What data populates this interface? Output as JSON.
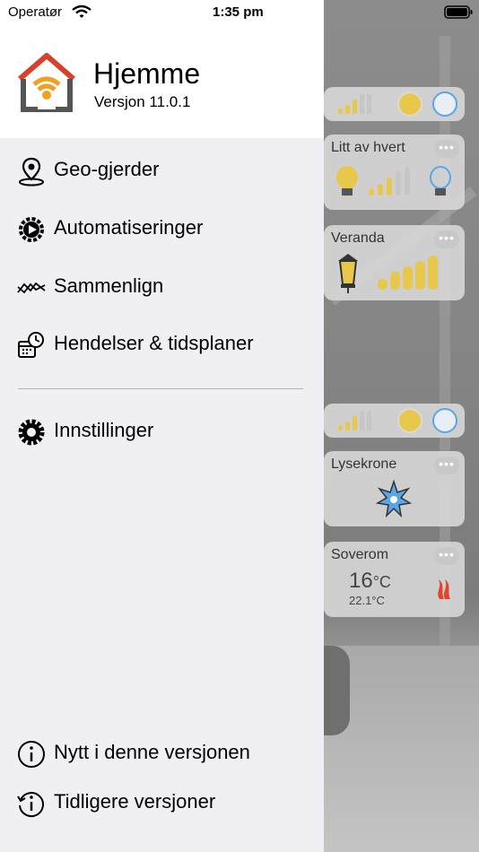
{
  "status_bar": {
    "carrier": "Operatør",
    "time": "1:35 pm"
  },
  "app": {
    "title": "Hjemme",
    "version": "Versjon 11.0.1"
  },
  "menu": {
    "geo": "Geo-gjerder",
    "automations": "Automatiseringer",
    "compare": "Sammenlign",
    "events": "Hendelser & tidsplaner",
    "settings": "Innstillinger",
    "whats_new": "Nytt i denne versjonen",
    "previous": "Tidligere versjoner"
  },
  "background_cards": {
    "c1": "Litt av hvert",
    "c2": "Veranda",
    "c3": "Lysekrone",
    "c4": "Soverom",
    "temp_main": "16",
    "temp_unit": "°C",
    "temp_sub": "22.1°C"
  },
  "colors": {
    "accent_yellow": "#e8c84a",
    "blue": "#5aa6e6",
    "flame": "#e0452f"
  }
}
